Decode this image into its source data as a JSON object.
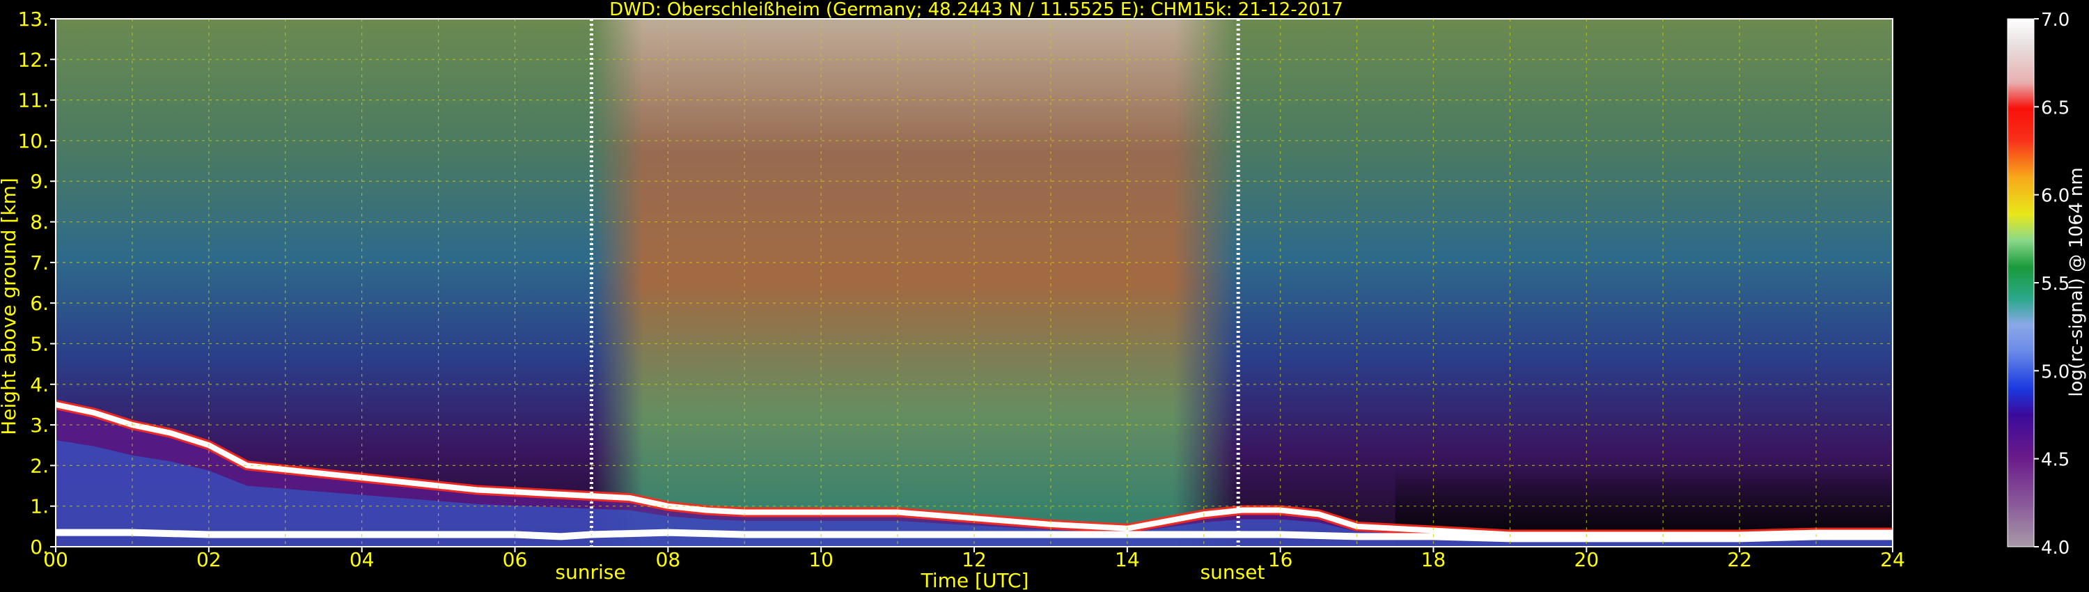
{
  "chart_data": {
    "type": "heatmap",
    "title": "DWD: Oberschleißheim (Germany; 48.2443 N / 11.5525 E):    CHM15k: 21-12-2017",
    "xlabel": "Time [UTC]",
    "ylabel": "Height above ground [km]",
    "x_ticks": [
      "00",
      "02",
      "04",
      "06",
      "08",
      "10",
      "12",
      "14",
      "16",
      "18",
      "20",
      "22",
      "24"
    ],
    "y_ticks": [
      "0.",
      "1.",
      "2.",
      "3.",
      "4.",
      "5.",
      "6.",
      "7.",
      "8.",
      "9.",
      "10.",
      "11.",
      "12.",
      "13."
    ],
    "xlim": [
      0,
      24
    ],
    "ylim": [
      0,
      13
    ],
    "grid": true,
    "sunrise": {
      "label": "sunrise",
      "time": 7.0
    },
    "sunset": {
      "label": "sunset",
      "time": 15.45
    },
    "colorbar": {
      "label": "log(rc-signal) @ 1064 nm",
      "range": [
        4.0,
        7.0
      ],
      "ticks": [
        "7.0",
        "6.5",
        "6.0",
        "5.5",
        "5.0",
        "4.5",
        "4.0"
      ]
    },
    "bands": [
      {
        "name": "boundary-layer-top",
        "points": [
          [
            0,
            0.35
          ],
          [
            1,
            0.35
          ],
          [
            2,
            0.3
          ],
          [
            3,
            0.3
          ],
          [
            4,
            0.3
          ],
          [
            5,
            0.3
          ],
          [
            6,
            0.3
          ],
          [
            6.6,
            0.25
          ],
          [
            7,
            0.3
          ],
          [
            8,
            0.35
          ],
          [
            9,
            0.3
          ],
          [
            10,
            0.3
          ],
          [
            11,
            0.3
          ],
          [
            12,
            0.3
          ],
          [
            13,
            0.3
          ],
          [
            14,
            0.3
          ],
          [
            15,
            0.3
          ],
          [
            16,
            0.3
          ],
          [
            17,
            0.25
          ],
          [
            18,
            0.25
          ],
          [
            19,
            0.2
          ],
          [
            20,
            0.2
          ],
          [
            21,
            0.2
          ],
          [
            22,
            0.2
          ],
          [
            23,
            0.25
          ],
          [
            24,
            0.25
          ]
        ]
      },
      {
        "name": "cloud-layer",
        "points": [
          [
            0,
            3.5
          ],
          [
            0.5,
            3.3
          ],
          [
            1,
            3.0
          ],
          [
            1.5,
            2.8
          ],
          [
            2,
            2.5
          ],
          [
            2.5,
            2.0
          ],
          [
            3,
            1.9
          ],
          [
            3.5,
            1.8
          ],
          [
            4,
            1.7
          ],
          [
            4.5,
            1.6
          ],
          [
            5,
            1.5
          ],
          [
            5.5,
            1.4
          ],
          [
            6,
            1.35
          ],
          [
            6.5,
            1.3
          ],
          [
            7,
            1.25
          ],
          [
            7.5,
            1.2
          ],
          [
            8,
            1.0
          ],
          [
            8.5,
            0.9
          ],
          [
            9,
            0.85
          ],
          [
            10,
            0.85
          ],
          [
            11,
            0.85
          ],
          [
            12,
            0.7
          ],
          [
            13,
            0.55
          ],
          [
            14,
            0.45
          ],
          [
            15,
            0.8
          ],
          [
            15.5,
            0.9
          ],
          [
            16,
            0.9
          ],
          [
            16.5,
            0.8
          ],
          [
            17,
            0.5
          ],
          [
            18,
            0.4
          ],
          [
            19,
            0.3
          ],
          [
            20,
            0.3
          ],
          [
            21,
            0.3
          ],
          [
            22,
            0.3
          ],
          [
            23,
            0.35
          ],
          [
            24,
            0.35
          ]
        ]
      }
    ],
    "colors": {
      "axes": "#ffff00",
      "marker": "#ffffff",
      "background": "#000000"
    }
  }
}
